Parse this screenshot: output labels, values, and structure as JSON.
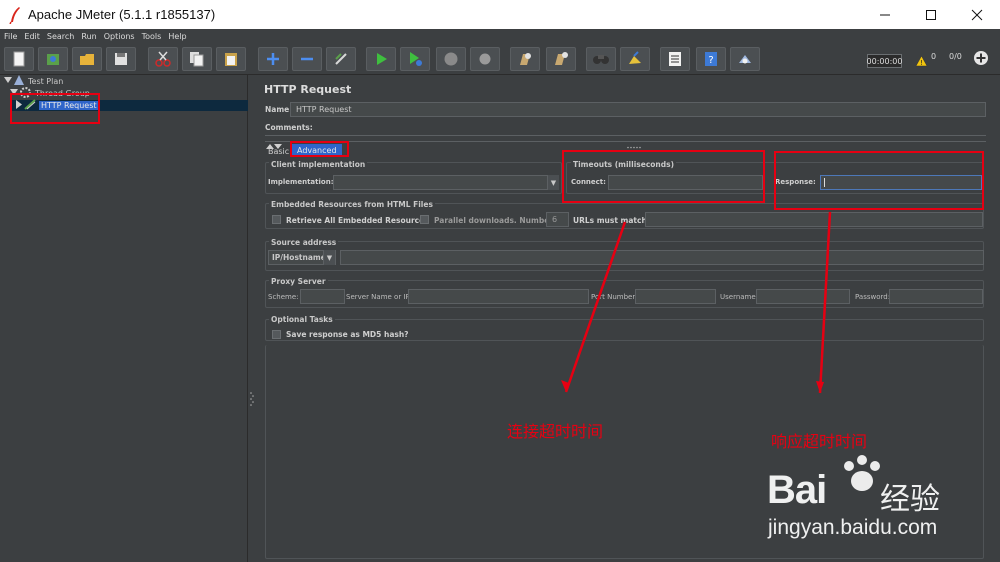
{
  "window": {
    "title": "Apache JMeter (5.1.1 r1855137)",
    "minimize_icon": "minimize-icon",
    "maximize_icon": "maximize-icon",
    "close_icon": "close-icon"
  },
  "menu": [
    "File",
    "Edit",
    "Search",
    "Run",
    "Options",
    "Tools",
    "Help"
  ],
  "toolbar": {
    "timer": "00:00:00",
    "warnings": "0",
    "threads": "0/0"
  },
  "tree": {
    "items": [
      {
        "label": "Test Plan",
        "icon": "test-plan-icon"
      },
      {
        "label": "Thread Group",
        "icon": "thread-group-icon"
      },
      {
        "label": "HTTP Request",
        "icon": "http-sampler-icon",
        "selected": true
      }
    ]
  },
  "panel": {
    "title": "HTTP Request",
    "name_label": "Name:",
    "name_value": "HTTP Request",
    "comments_label": "Comments:",
    "tab_basic": "Basic",
    "tab_advanced": "Advanced",
    "client_impl": {
      "title": "Client implementation",
      "impl_label": "Implementation:",
      "impl_value": ""
    },
    "timeouts": {
      "title": "Timeouts (milliseconds)",
      "connect_label": "Connect:",
      "connect_value": "",
      "response_label": "Response:",
      "response_value": ""
    },
    "embedded": {
      "title": "Embedded Resources from HTML Files",
      "retrieve_label": "Retrieve All Embedded Resources",
      "retrieve_checked": false,
      "parallel_label": "Parallel downloads. Number:",
      "parallel_checked": false,
      "parallel_number": "6",
      "urls_label": "URLs must match:",
      "urls_value": ""
    },
    "source": {
      "title": "Source address",
      "type_value": "IP/Hostname",
      "address_value": ""
    },
    "proxy": {
      "title": "Proxy Server",
      "scheme_label": "Scheme:",
      "server_label": "Server Name or IP:",
      "port_label": "Port Number:",
      "username_label": "Username:",
      "password_label": "Password:"
    },
    "optional": {
      "title": "Optional Tasks",
      "md5_label": "Save response as MD5 hash?",
      "md5_checked": false
    }
  },
  "annotations": {
    "connect_note": "连接超时时间",
    "response_note": "响应超时时间",
    "highlight_color": "#e60012"
  },
  "watermark": {
    "brand": "Bai",
    "brand2": "经验",
    "url": "jingyan.baidu.com"
  },
  "colors": {
    "background": "#3c3f41",
    "selection": "#2f65ca",
    "annotation": "#e60012"
  }
}
